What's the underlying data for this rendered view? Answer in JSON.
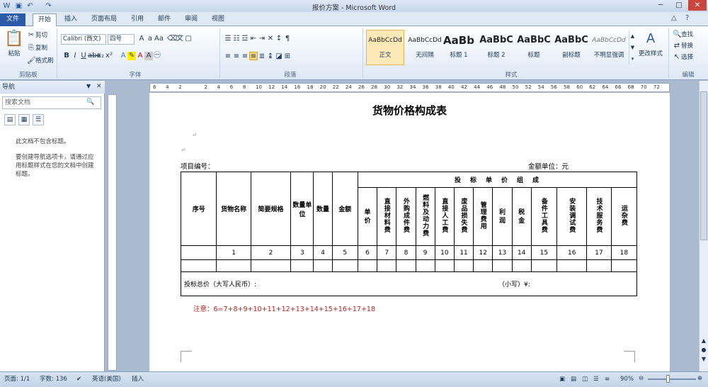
{
  "window": {
    "title": "报价方案 - Microsoft Word"
  },
  "tabs": [
    {
      "label": "文件"
    },
    {
      "label": "开始"
    },
    {
      "label": "插入"
    },
    {
      "label": "页面布局"
    },
    {
      "label": "引用"
    },
    {
      "label": "邮件"
    },
    {
      "label": "审阅"
    },
    {
      "label": "视图"
    }
  ],
  "ribbon": {
    "clipboard": {
      "paste": "粘贴",
      "cut": "剪切",
      "copy": "复制",
      "format_painter": "格式刷",
      "group": "剪贴板"
    },
    "font": {
      "font_name": "Calibri (西文)",
      "font_size": "四号",
      "group": "字体"
    },
    "paragraph": {
      "group": "段落"
    },
    "styles": {
      "group": "样式",
      "items": [
        {
          "preview": "AaBbCcDd",
          "name": "正文"
        },
        {
          "preview": "AaBbCcDd",
          "name": "无间隔"
        },
        {
          "preview": "AaBb",
          "name": "标题 1"
        },
        {
          "preview": "AaBbC",
          "name": "标题 2"
        },
        {
          "preview": "AaBbC",
          "name": "标题"
        },
        {
          "preview": "AaBbC",
          "name": "副标题"
        },
        {
          "preview": "AaBbCcDd",
          "name": "不明显强调"
        }
      ],
      "change_styles": "更改样式"
    },
    "editing": {
      "find": "查找",
      "replace": "替换",
      "select": "选择",
      "group": "编辑"
    }
  },
  "nav": {
    "title": "导航",
    "search_placeholder": "搜索文档",
    "msg1": "此文档不包含标题。",
    "msg2": "要创建导航选项卡，请通过应用标题样式在您的文档中创建标题。"
  },
  "ruler": {
    "h_ticks": [
      "6",
      "4",
      "2",
      "",
      "2",
      "4",
      "6",
      "8",
      "10",
      "12",
      "14",
      "16",
      "18",
      "20",
      "22",
      "24",
      "26",
      "28",
      "30",
      "32",
      "34",
      "36",
      "38",
      "40",
      "42",
      "44",
      "46",
      "48",
      "50",
      "52",
      "54",
      "56",
      "58",
      "60",
      "62",
      "64",
      "66",
      "68",
      "70",
      "72"
    ]
  },
  "document": {
    "title": "货物价格构成表",
    "project_no": "项目编号：",
    "amount_unit": "金额单位：元",
    "table": {
      "fixed_headers": [
        "序号",
        "货物名称",
        "简要规格",
        "数量单位",
        "数量",
        "金额"
      ],
      "group_header": "投　标　单　价　组　成",
      "sub_headers": [
        "单价",
        "直接材料费",
        "外购成件费",
        "燃料及动力费",
        "直接人工费",
        "废品损失费",
        "管理费用",
        "利润",
        "税金",
        "备件工具费",
        "安装调试费",
        "技术服务费",
        "运杂费"
      ],
      "number_row": [
        "",
        "1",
        "2",
        "3",
        "4",
        "5",
        "6",
        "7",
        "8",
        "9",
        "10",
        "11",
        "12",
        "13",
        "14",
        "15",
        "16",
        "17",
        "18"
      ],
      "total_label": "投标总价（大写人民币）:",
      "small_label": "（小写）¥:"
    },
    "note": "注意：6=7+8+9+10+11+12+13+14+15+16+17+18"
  },
  "status": {
    "page": "页面: 1/1",
    "words": "字数: 136",
    "language": "英语(美国)",
    "insert": "插入",
    "zoom": "90%"
  }
}
